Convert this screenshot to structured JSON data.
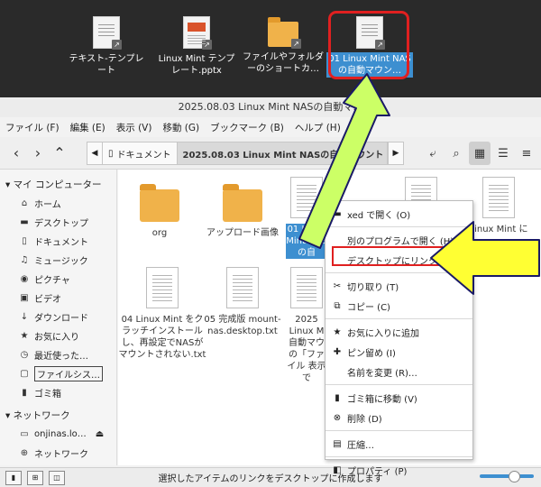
{
  "desktop": {
    "icons": [
      {
        "label": "テキスト-テンプレート"
      },
      {
        "label": "Linux Mint テンプレート.pptx"
      },
      {
        "label": "ファイルやフォルダーのショートカ…"
      },
      {
        "label": "01 Linux Mint NASの自動マウン…"
      }
    ]
  },
  "window": {
    "title": "2025.08.03 Linux Mint NASの自動マ…",
    "menu": [
      "ファイル (F)",
      "編集 (E)",
      "表示 (V)",
      "移動 (G)",
      "ブックマーク (B)",
      "ヘルプ (H)"
    ],
    "breadcrumbs": [
      "ドキュメント",
      "2025.08.03 Linux Mint NASの自動マウント"
    ]
  },
  "sidebar": {
    "my_computer": "マイ コンピューター",
    "items": [
      "ホーム",
      "デスクトップ",
      "ドキュメント",
      "ミュージック",
      "ピクチャ",
      "ビデオ",
      "ダウンロード",
      "お気に入り",
      "最近使った…",
      "ファイルシス…",
      "ゴミ箱"
    ],
    "network": "ネットワーク",
    "network_items": [
      "onjinas.lo…",
      "ネットワーク"
    ]
  },
  "files": [
    {
      "name": "org"
    },
    {
      "name": "アップロード画像"
    },
    {
      "name": "01 Linux Mint NASの自"
    },
    {
      "name": ""
    },
    {
      "name": "Linux Mint に"
    },
    {
      "name": "04 Linux Mint をクラッチインストールし、再設定でNASがマウントされない.txt"
    },
    {
      "name": "05 完成版 mount-nas.desktop.txt"
    },
    {
      "name": "2025 Linux M 自動マウ の「ファイル 表示で"
    }
  ],
  "context_menu": {
    "items": [
      {
        "label": "xed で開く (O)"
      },
      {
        "label": "別のプログラムで開く (H)"
      },
      {
        "label": "デスクトップにリンクを作成"
      },
      {
        "label": "切り取り (T)"
      },
      {
        "label": "コピー (C)"
      },
      {
        "label": "お気に入りに追加"
      },
      {
        "label": "ピン留め (I)"
      },
      {
        "label": "名前を変更 (R)…"
      },
      {
        "label": "ゴミ箱に移動 (V)"
      },
      {
        "label": "削除 (D)"
      },
      {
        "label": "圧縮…"
      },
      {
        "label": "プロパティ (P)"
      }
    ]
  },
  "statusbar": {
    "text": "選択したアイテムのリンクをデスクトップに作成します"
  },
  "colors": {
    "selection": "#3d8fd0",
    "highlight_red": "#e02020",
    "arrow_yellow": "#ffff33",
    "arrow_green": "#ccff66"
  }
}
